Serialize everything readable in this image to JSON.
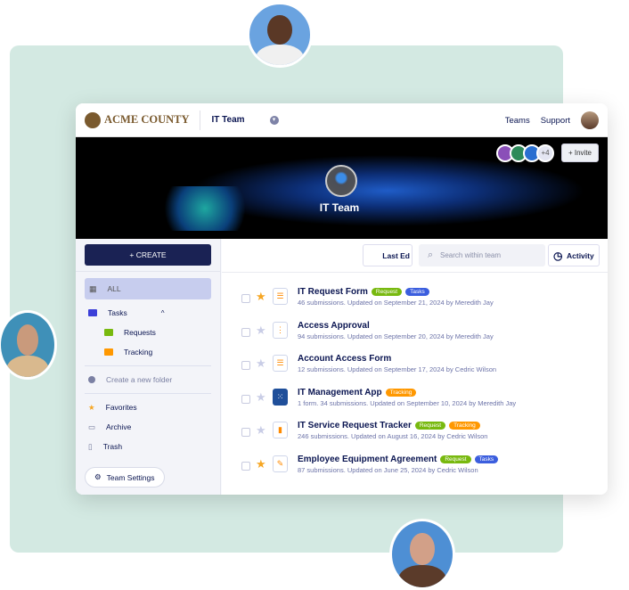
{
  "colors": {
    "accent": "#1a2254",
    "request": "#78b90f",
    "tasks": "#3b5ede",
    "tracking": "#ff9800",
    "favorite": "#f6a623"
  },
  "header": {
    "logo": "ACME COUNTY",
    "team": "IT Team",
    "nav": [
      "Teams",
      "Support"
    ]
  },
  "banner": {
    "team_name": "IT Team",
    "member_extra": "+4",
    "invite": "+ Invite"
  },
  "sidebar": {
    "create": "+ CREATE",
    "all": "ALL",
    "folders": [
      {
        "label": "Tasks",
        "color": "#3b3fd8"
      },
      {
        "label": "Requests",
        "color": "#78b90f"
      },
      {
        "label": "Tracking",
        "color": "#ff9800"
      }
    ],
    "create_folder": "Create a new folder",
    "favorites": "Favorites",
    "archive": "Archive",
    "trash": "Trash",
    "settings": "Team Settings"
  },
  "toolbar": {
    "sort": "Last Ed",
    "search_placeholder": "Search within team",
    "activity": "Activity"
  },
  "items": [
    {
      "title": "IT Request Form",
      "tags": [
        "Request",
        "Tasks"
      ],
      "meta": "46 submissions. Updated on September 21, 2024 by Meredith Jay",
      "starred": true,
      "icon": "form-icon"
    },
    {
      "title": "Access Approval",
      "tags": [],
      "meta": "94 submissions. Updated on September 20, 2024 by Meredith Jay",
      "starred": false,
      "icon": "workflow-icon"
    },
    {
      "title": "Account Access Form",
      "tags": [],
      "meta": "12 submissions. Updated on September 17, 2024 by Cedric Wilson",
      "starred": false,
      "icon": "form-icon"
    },
    {
      "title": "IT Management App",
      "tags": [
        "Tracking"
      ],
      "meta": "1 form. 34 submissions. Updated on September 10, 2024 by Meredith Jay",
      "starred": false,
      "icon": "app-icon"
    },
    {
      "title": "IT Service Request Tracker",
      "tags": [
        "Request",
        "Tracking"
      ],
      "meta": "246 submissions. Updated on August 16, 2024 by Cedric Wilson",
      "starred": false,
      "icon": "report-icon"
    },
    {
      "title": "Employee Equipment Agreement",
      "tags": [
        "Request",
        "Tasks"
      ],
      "meta": "87 submissions. Updated on June 25, 2024 by Cedric Wilson",
      "starred": true,
      "icon": "sign-document-icon"
    }
  ]
}
